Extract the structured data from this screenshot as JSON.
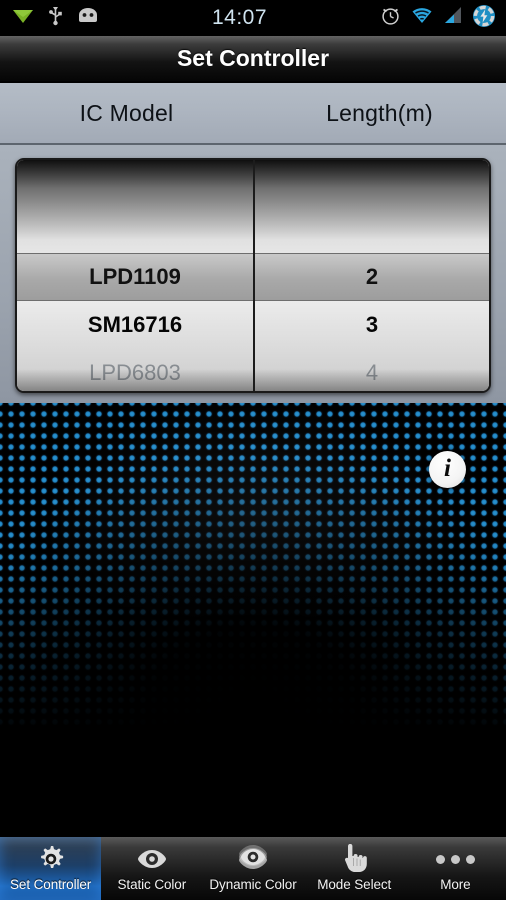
{
  "status_bar": {
    "clock": "14:07",
    "left_icons": [
      {
        "name": "location-triangle-icon",
        "glyph": "▼",
        "color": "#79b125"
      },
      {
        "name": "usb-icon",
        "glyph": "USB",
        "color": "#c8c8c8"
      },
      {
        "name": "android-debug-icon",
        "glyph": "android",
        "color": "#c8c8c8"
      }
    ],
    "right_icons": [
      {
        "name": "alarm-clock-icon",
        "glyph": "alarm",
        "color": "#cfcfcf"
      },
      {
        "name": "wifi-icon",
        "glyph": "wifi",
        "color": "#2aa7e0"
      },
      {
        "name": "cell-signal-icon",
        "glyph": "signal",
        "color": "#2aa7e0"
      },
      {
        "name": "battery-charging-icon",
        "glyph": "bolt",
        "color": "#2aa7e0"
      }
    ]
  },
  "title_bar": {
    "title": "Set Controller"
  },
  "column_header": {
    "ic_model": "IC Model",
    "length": "Length(m)"
  },
  "picker": {
    "ic_model": {
      "blank": "",
      "items": [
        {
          "label": "LPD1109",
          "state": "highlight"
        },
        {
          "label": "SM16716",
          "state": "selected"
        },
        {
          "label": "LPD6803",
          "state": "dim"
        }
      ]
    },
    "length": {
      "blank": "",
      "items": [
        {
          "label": "2",
          "state": "highlight"
        },
        {
          "label": "3",
          "state": "selected"
        },
        {
          "label": "4",
          "state": "dim"
        }
      ]
    }
  },
  "info_button": {
    "glyph": "i",
    "name": "info-button"
  },
  "tab_bar": {
    "tabs": [
      {
        "label": "Set Controller",
        "icon": "gear-icon",
        "active": true
      },
      {
        "label": "Static Color",
        "icon": "eye-icon",
        "active": false
      },
      {
        "label": "Dynamic Color",
        "icon": "layered-eye-icon",
        "active": false
      },
      {
        "label": "Mode Select",
        "icon": "pointing-hand-icon",
        "active": false
      },
      {
        "label": "More",
        "icon": "three-dots-icon",
        "active": false
      }
    ]
  },
  "colors": {
    "accent_blue": "#2178d8",
    "header_bg": "#adb5c0",
    "wallpaper_dot": "#2188c8",
    "title_text": "#ffffff"
  }
}
